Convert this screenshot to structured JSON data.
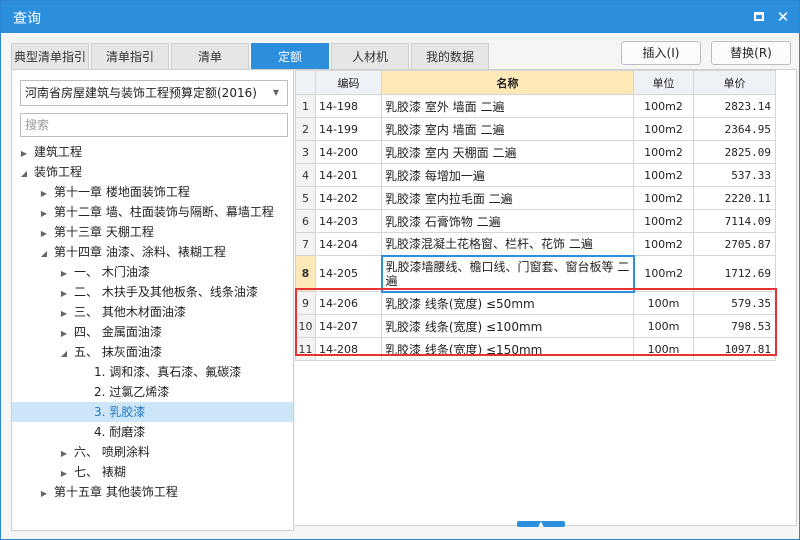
{
  "window": {
    "title": "查询"
  },
  "tabs": [
    "典型清单指引",
    "清单指引",
    "清单",
    "定额",
    "人材机",
    "我的数据"
  ],
  "active_tab": "定额",
  "actions": {
    "insert": "插入(I)",
    "replace": "替换(R)"
  },
  "left": {
    "quota_select": "河南省房屋建筑与装饰工程预算定额(2016)",
    "search_placeholder": "搜索",
    "tree": [
      {
        "label": "建筑工程",
        "level": 0,
        "toggle": "collapsed"
      },
      {
        "label": "装饰工程",
        "level": 0,
        "toggle": "expanded"
      },
      {
        "label": "第十一章 楼地面装饰工程",
        "level": 1,
        "toggle": "collapsed"
      },
      {
        "label": "第十二章 墙、柱面装饰与隔断、幕墙工程",
        "level": 1,
        "toggle": "collapsed"
      },
      {
        "label": "第十三章 天棚工程",
        "level": 1,
        "toggle": "collapsed"
      },
      {
        "label": "第十四章 油漆、涂料、裱糊工程",
        "level": 1,
        "toggle": "expanded"
      },
      {
        "label": "一、 木门油漆",
        "level": 2,
        "toggle": "collapsed"
      },
      {
        "label": "二、 木扶手及其他板条、线条油漆",
        "level": 2,
        "toggle": "collapsed"
      },
      {
        "label": "三、 其他木材面油漆",
        "level": 2,
        "toggle": "collapsed"
      },
      {
        "label": "四、 金属面油漆",
        "level": 2,
        "toggle": "collapsed"
      },
      {
        "label": "五、 抹灰面油漆",
        "level": 2,
        "toggle": "expanded"
      },
      {
        "label": "1. 调和漆、真石漆、氟碳漆",
        "level": 3,
        "toggle": "none"
      },
      {
        "label": "2. 过氯乙烯漆",
        "level": 3,
        "toggle": "none"
      },
      {
        "label": "3. 乳胶漆",
        "level": 3,
        "toggle": "none",
        "selected": true
      },
      {
        "label": "4. 耐磨漆",
        "level": 3,
        "toggle": "none"
      },
      {
        "label": "六、 喷刷涂料",
        "level": 2,
        "toggle": "collapsed"
      },
      {
        "label": "七、 裱糊",
        "level": 2,
        "toggle": "collapsed"
      },
      {
        "label": "第十五章 其他装饰工程",
        "level": 1,
        "toggle": "collapsed"
      }
    ]
  },
  "grid": {
    "headers": {
      "code": "编码",
      "name": "名称",
      "unit": "单位",
      "price": "单价"
    },
    "rows": [
      {
        "idx": "1",
        "code": "14-198",
        "name": "乳胶漆 室外 墙面 二遍",
        "unit": "100m2",
        "price": "2823.14"
      },
      {
        "idx": "2",
        "code": "14-199",
        "name": "乳胶漆 室内 墙面 二遍",
        "unit": "100m2",
        "price": "2364.95"
      },
      {
        "idx": "3",
        "code": "14-200",
        "name": "乳胶漆 室内 天棚面 二遍",
        "unit": "100m2",
        "price": "2825.09"
      },
      {
        "idx": "4",
        "code": "14-201",
        "name": "乳胶漆 每增加一遍",
        "unit": "100m2",
        "price": "537.33"
      },
      {
        "idx": "5",
        "code": "14-202",
        "name": "乳胶漆 室内拉毛面 二遍",
        "unit": "100m2",
        "price": "2220.11"
      },
      {
        "idx": "6",
        "code": "14-203",
        "name": "乳胶漆 石膏饰物 二遍",
        "unit": "100m2",
        "price": "7114.09"
      },
      {
        "idx": "7",
        "code": "14-204",
        "name": "乳胶漆混凝土花格窗、栏杆、花饰 二遍",
        "unit": "100m2",
        "price": "2705.87"
      },
      {
        "idx": "8",
        "code": "14-205",
        "name": "乳胶漆墙腰线、檐口线、门窗套、窗台板等 二遍",
        "unit": "100m2",
        "price": "1712.69"
      },
      {
        "idx": "9",
        "code": "14-206",
        "name": "乳胶漆 线条(宽度) ≤50mm",
        "unit": "100m",
        "price": "579.35"
      },
      {
        "idx": "10",
        "code": "14-207",
        "name": "乳胶漆 线条(宽度) ≤100mm",
        "unit": "100m",
        "price": "798.53"
      },
      {
        "idx": "11",
        "code": "14-208",
        "name": "乳胶漆 线条(宽度) ≤150mm",
        "unit": "100m",
        "price": "1097.81"
      }
    ]
  },
  "colors": {
    "accent": "#2b8fde",
    "highlight_box": "#e53333",
    "header_name_bg": "#fde9b8"
  }
}
